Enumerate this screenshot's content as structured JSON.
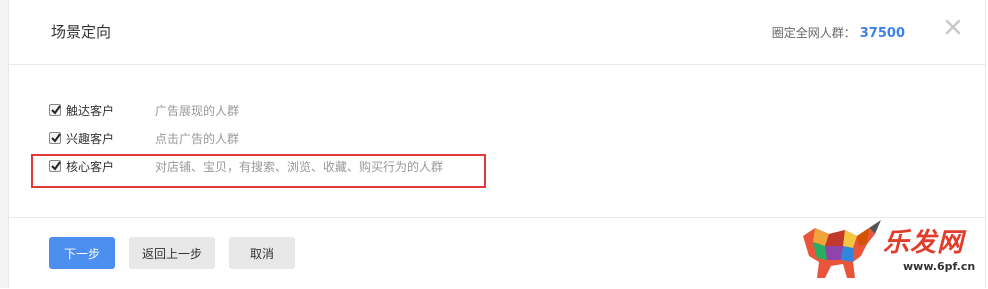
{
  "dialog": {
    "title": "场景定向",
    "audience_label": "圈定全网人群：",
    "audience_count": "37500"
  },
  "options": [
    {
      "label": "触达客户",
      "desc": "广告展现的人群",
      "checked": true
    },
    {
      "label": "兴趣客户",
      "desc": "点击广告的人群",
      "checked": true
    },
    {
      "label": "核心客户",
      "desc": "对店铺、宝贝，有搜索、浏览、收藏、购买行为的人群",
      "checked": true
    }
  ],
  "buttons": {
    "next": "下一步",
    "back": "返回上一步",
    "cancel": "取消"
  },
  "watermark": {
    "logo_text": "乐发网",
    "url": "www.6pf.cn"
  },
  "colors": {
    "primary": "#4d8ff0",
    "highlight": "#e03a3a",
    "count": "#3c82e6"
  },
  "icons": {
    "close": "close-icon",
    "checkbox": "checkmark-icon"
  }
}
